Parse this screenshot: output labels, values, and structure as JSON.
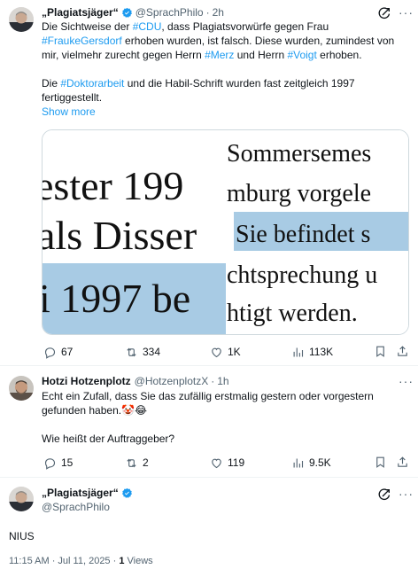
{
  "tweet1": {
    "name": "„Plagiatsjäger“",
    "handle": "@SprachPhilo",
    "dot": "·",
    "time": "2h",
    "line1_pre": "Die Sichtweise der ",
    "tag_cdu": "#CDU",
    "line1_post": ", dass Plagiatsvorwürfe gegen Frau",
    "tag_frauke": "#FraukeGersdorf",
    "line2_post": " erhoben wurden, ist falsch. Diese wurden, zumindest von",
    "line3_pre": "mir, vielmehr zurecht gegen Herrn ",
    "tag_merz": "#Merz",
    "line3_mid": " und Herrn ",
    "tag_voigt": "#Voigt",
    "line3_post": " erhoben.",
    "para2_pre": "Die ",
    "tag_doktor": "#Doktorarbeit",
    "para2_post": " und die Habil-Schrift wurden fast zeitgleich 1997",
    "para2_line2": "fertiggestellt.",
    "show_more": "Show more",
    "image_left": {
      "row1": "ester 199",
      "row2": "als Disser",
      "row3": "i 1997 be"
    },
    "image_right": {
      "row1": "Sommersemes",
      "row2": "mburg vorgele",
      "row3": "Sie befindet s",
      "row4": "chtsprechung u",
      "row5": "htigt werden."
    },
    "replies": "67",
    "reposts": "334",
    "likes": "1K",
    "views": "113K"
  },
  "tweet2": {
    "name": "Hotzi Hotzenplotz",
    "handle": "@HotzenplotzX",
    "dot": "·",
    "time": "1h",
    "line1": "Echt ein Zufall, dass Sie das zufällig erstmalig gestern oder vorgestern",
    "line2": "gefunden haben.🤡😂",
    "line3": "Wie heißt der Auftraggeber?",
    "replies": "15",
    "reposts": "2",
    "likes": "119",
    "views": "9.5K"
  },
  "main": {
    "name": "„Plagiatsjäger“",
    "handle": "@SprachPhilo",
    "text": "NIUS",
    "timestamp": "11:15 AM · Jul 11, 2025 · ",
    "views_count": "1",
    "views_label": " Views"
  },
  "colors": {
    "link": "#1d9bf0",
    "secondary": "#536471",
    "highlight": "#a8cbe4"
  },
  "icons": [
    "verified-badge-icon",
    "grok-icon",
    "more-icon",
    "reply-icon",
    "repost-icon",
    "like-icon",
    "views-icon",
    "bookmark-icon",
    "share-icon"
  ]
}
